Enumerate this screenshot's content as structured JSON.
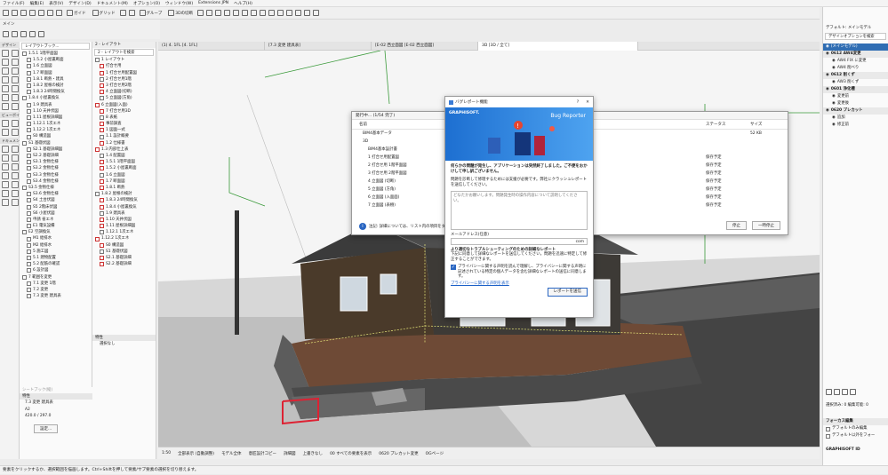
{
  "menu": [
    "ファイル(F)",
    "編集(E)",
    "表示(V)",
    "デザイン(D)",
    "ドキュメント(M)",
    "オプション(O)",
    "ウィンドウ(W)",
    "Extensions JPN",
    "ヘルプ(H)"
  ],
  "toolbar": {
    "guide": "ガイド",
    "grid": "グリッド",
    "group": "グループ",
    "cut3d": "3Dの切断",
    "mode": "メイン"
  },
  "left_tabs": {
    "design": "デザイン",
    "viewpoint": "ビューポイント",
    "document": "ドキュメント"
  },
  "nav": {
    "search_placeholder": "レイアウトブック...",
    "items": [
      "1.5.1 1階平面図",
      "1.5.2 小屋裏断面",
      "1.6 立面図",
      "1.7 断面図",
      "1.8.1 断熱・建具",
      "1.8.2 屋根の検討",
      "1.8.3 24時間換気",
      "1.8.4 小屋裏換気",
      "1.9 建具表",
      "1.10 天井伏図",
      "1.11 屋根詳細図",
      "1.12.1 1次エネ",
      "1.12.2 1次エネ",
      "S0 構造図",
      "S1 基礎伏図",
      "S2.1 基礎詳細図",
      "S2.2 基礎詳細",
      "S3.1 金物仕様",
      "S3.2 金物仕様",
      "S3.3 金物仕様",
      "S3.4 金物仕様",
      "S3.5 金物仕様",
      "S3.6 金物仕様",
      "S4 土台伏図",
      "S5 2階床伏図",
      "S6 小屋伏図",
      "申請 省エネ",
      "E1 電気設備",
      "E2 空調換気",
      "M1 給排水",
      "M2 給排水",
      "5 施工図",
      "5.1 建物配置",
      "5.2 配筋の確認",
      "6 設計図",
      "7 範囲を変更",
      "7.1 変更 1階",
      "7.2 変更",
      "7.3 変更 建具表"
    ]
  },
  "nav2": {
    "title": "2 - レイアウト",
    "search_placeholder": "2 - レイアウトを検索",
    "items": [
      "1 レイアウト",
      "打合せ用",
      "1 打合せ用配置図",
      "2 打合せ用1階",
      "3 打合せ用2階",
      "4 立面図(切断)",
      "5 立面図(方角)",
      "6 立面図(入面)",
      "7 打合せ用3D",
      "8 表紙",
      "事前調査",
      "1 図面一式",
      "1.1 設計概要",
      "1.2 仕様書",
      "1.3 内部仕上表",
      "1.4 配置図",
      "1.5.1 1階平面図",
      "1.5.2 小屋裏断面",
      "1.6 立面図",
      "1.7 断面図",
      "1.8.1 断熱",
      "1.8.2 屋根の検討",
      "1.8.3 24時間換気",
      "1.8.4 小屋裏換気",
      "1.9 建具表",
      "1.10 天井伏図",
      "1.11 屋根詳細図",
      "1.12.1 1次エネ",
      "1.12.2 1次エネ",
      "S0 構造図",
      "S1 基礎伏図",
      "S2.1 基礎詳細",
      "S2.2 基礎詳細"
    ],
    "props_title": "特性",
    "props_value": "選択なし"
  },
  "props_left": {
    "title": "特性",
    "row1": "7.3 変更 建具表",
    "row2": "A2",
    "row3": "420.0 / 297.0",
    "settings": "設定...",
    "layout_book": "シートブック(縦)"
  },
  "tabs": [
    "(1) 4. 1FL [4. 1FL]",
    "[7.3 変更 建具表]",
    "[E-02 西立面図 [E-02 西立面図]",
    "3D [3D / 全て]"
  ],
  "status": {
    "zoom": "1:50",
    "scale": "全部表示 (自動調整)",
    "model": "モデル全体",
    "layout_comp": "意匠設計コピー",
    "detail": "詳細図",
    "up": "上書きなし",
    "pen": "00 すべての要素を表示",
    "renov": "0620 プレカット変更",
    "og": "OGページ"
  },
  "bottom_hint": "要素をクリックするか、選択範囲を描画します。Ctrl+Shiftを押して要素/サブ要素の選択を切り替えます。",
  "progress_dialog": {
    "title": "発行中... (1/54 完了)",
    "col_name": "名前",
    "col_status": "ステータス",
    "col_size": "サイズ",
    "rows": [
      {
        "name": "BIM4基本データ",
        "status": "",
        "size": "52 KB"
      },
      {
        "name": "3D",
        "status": "",
        "size": ""
      },
      {
        "name": "BIM4基本設計書",
        "status": "",
        "size": ""
      },
      {
        "name": "1 打合せ用配置図",
        "status": "保存予定",
        "size": ""
      },
      {
        "name": "2 打合せ用 1階平面図",
        "status": "保存予定",
        "size": ""
      },
      {
        "name": "3 打合せ用 2階平面図",
        "status": "保存予定",
        "size": ""
      },
      {
        "name": "4 立面図 (切断)",
        "status": "保存予定",
        "size": ""
      },
      {
        "name": "5 立面図 (方角)",
        "status": "保存予定",
        "size": ""
      },
      {
        "name": "6 立面図 (入面面)",
        "status": "保存予定",
        "size": ""
      },
      {
        "name": "7 立面図 (表樹)",
        "status": "保存予定",
        "size": ""
      }
    ],
    "note": "注記: 詳細については、リスト内の項目をダブル...",
    "stop": "停止",
    "pause": "一時停止"
  },
  "bug_dialog": {
    "title": "バグレポート機能",
    "brand": "GRAPHISOFT.",
    "banner": "Bug Reporter",
    "headline": "何らかの問題が発生し、アプリケーションは突然終了しました。ご不便をおかけして申し訳ございません。",
    "para": "問題を診断して修理するためには支援が必要です。弊社にクラッシュレポートを送信してください。",
    "textarea_placeholder": "どなたかお願いします。問題発生時の操作内容について説明してください。",
    "email_label": "メールアドレス(任意)",
    "email_value": "com",
    "privacy_head": "より適切なトラブルシューティングのための詳細なレポート",
    "privacy_text": "下記に同意して詳細なレポートを送信してください。問題を迅速に特定して修正することができます。",
    "checkbox_text": "プライバシーに関する声明を読んで理解し、プライバシーに関する声明に記述されている特定の個人データを含む詳細なレポートの送信に同意します。",
    "privacy_link": "プライバシーに関する声明を表示",
    "send": "レポートを送信"
  },
  "right_panel": {
    "title": "デフォルト: メインモデル",
    "search": "デザインオプションを検索",
    "items": [
      {
        "label": "(メインモデル)",
        "type": "sel"
      },
      {
        "label": "0612 AW4変更",
        "type": "group"
      },
      {
        "label": "AW4 FIX に変更",
        "type": "item"
      },
      {
        "label": "AW4 削べり",
        "type": "item"
      },
      {
        "label": "0612 削くず",
        "type": "group"
      },
      {
        "label": "AW3 削くず",
        "type": "item"
      },
      {
        "label": "0601 浄化槽",
        "type": "group"
      },
      {
        "label": "変更前",
        "type": "item"
      },
      {
        "label": "変更後",
        "type": "item"
      },
      {
        "label": "0620 プレカット",
        "type": "group"
      },
      {
        "label": "追加",
        "type": "item"
      },
      {
        "label": "修正前",
        "type": "item"
      }
    ],
    "bottom_head": "フォーカス編集",
    "sel_info": "選択済み: 0 編集可能: 0",
    "opt1": "デフォルトのみ編集",
    "opt2": "デフォルト以外をフォー",
    "brand": "GRAPHISOFT ID"
  }
}
